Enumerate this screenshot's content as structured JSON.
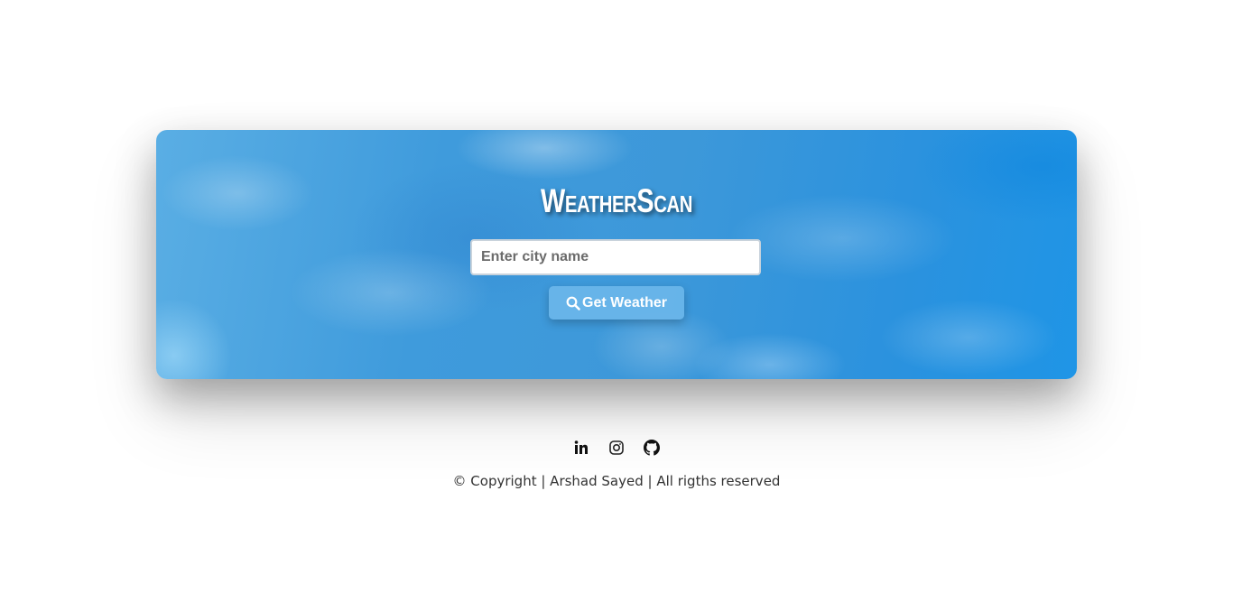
{
  "app": {
    "title": "WeatherScan"
  },
  "search": {
    "placeholder": "Enter city name",
    "value": ""
  },
  "button": {
    "icon": "search-icon",
    "label": "Get Weather"
  },
  "social": [
    {
      "name": "linkedin",
      "icon": "linkedin-icon"
    },
    {
      "name": "instagram",
      "icon": "instagram-icon"
    },
    {
      "name": "github",
      "icon": "github-icon"
    }
  ],
  "footer": {
    "copyright": "© Copyright | Arshad Sayed | All rigths reserved"
  },
  "colors": {
    "card_blue": "#3d98d9",
    "button_bg": "#6eb9eb",
    "text_dark": "#333333"
  }
}
